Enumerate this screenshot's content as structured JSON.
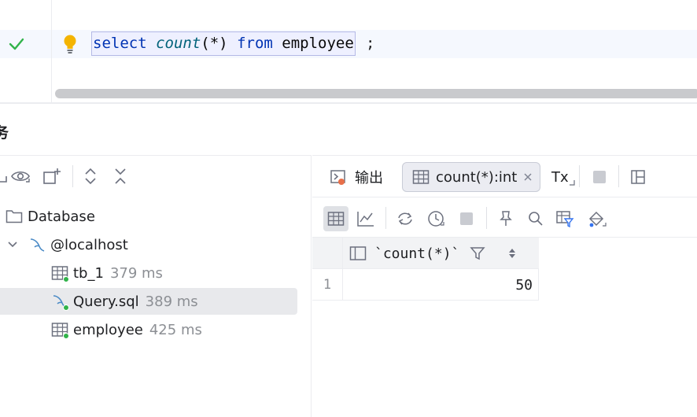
{
  "editor": {
    "code_select": "select",
    "code_count": "count",
    "code_args": "(*)",
    "code_from": "from",
    "code_table": "employee",
    "code_end": ";"
  },
  "panel": {
    "title": "务"
  },
  "tree": {
    "root_label": "Database",
    "host_label": "@localhost",
    "items": [
      {
        "label": "tb_1",
        "time": "379 ms"
      },
      {
        "label": "Query.sql",
        "time": "389 ms"
      },
      {
        "label": "employee",
        "time": "425 ms"
      }
    ]
  },
  "tabs": {
    "output_label": "输出",
    "result_label": "count(*):int",
    "tx_label": "Tx"
  },
  "grid": {
    "column_header": "`count(*)`",
    "rows": [
      {
        "num": "1",
        "value": "50"
      }
    ]
  },
  "colors": {
    "accent_green": "#31b34a",
    "keyword": "#0033b3",
    "function": "#00627a",
    "bulb": "#f4b400"
  }
}
